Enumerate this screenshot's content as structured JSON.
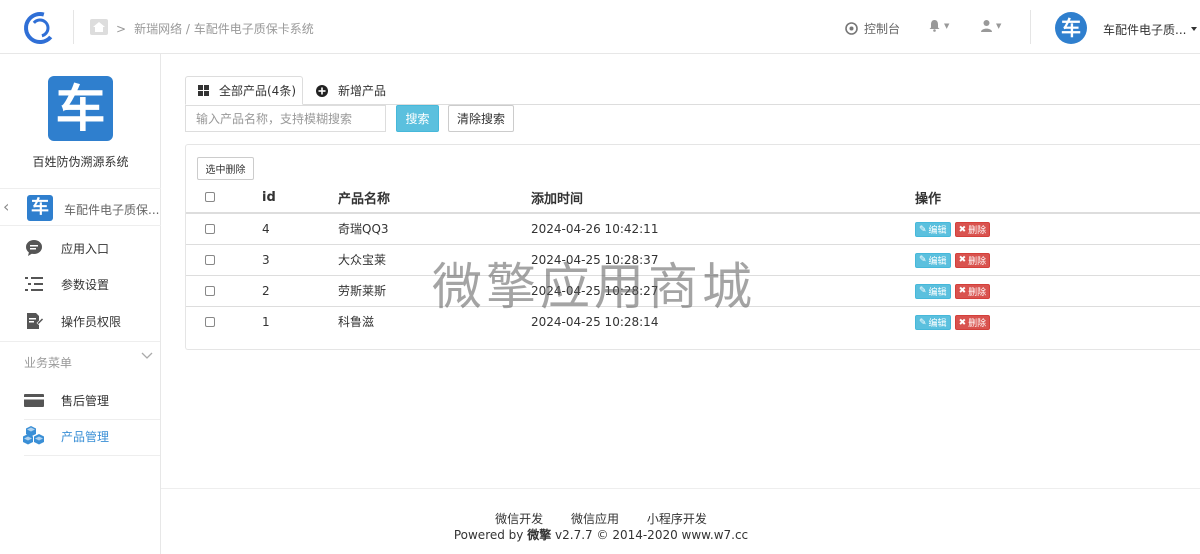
{
  "header": {
    "breadcrumb": "新瑞网络 / 车配件电子质保卡系统",
    "console": "控制台",
    "account_name": "车配件电子质...",
    "avatar_char": "车"
  },
  "sidebar": {
    "app_logo_char": "车",
    "app_name": "百姓防伪溯源系统",
    "sub_app_name": "车配件电子质保...",
    "items": [
      {
        "label": "应用入口",
        "icon": "chat-icon"
      },
      {
        "label": "参数设置",
        "icon": "list-settings-icon"
      },
      {
        "label": "操作员权限",
        "icon": "edit-doc-icon"
      }
    ],
    "section_label": "业务菜单",
    "biz_items": [
      {
        "label": "售后管理",
        "icon": "card-icon"
      },
      {
        "label": "产品管理",
        "icon": "cubes-icon",
        "active": true
      }
    ]
  },
  "tabs": [
    {
      "label": "全部产品(4条)",
      "icon": "grid-icon",
      "active": true
    },
    {
      "label": "新增产品",
      "icon": "plus-circle-icon"
    }
  ],
  "search": {
    "placeholder": "输入产品名称，支持模糊搜索",
    "value": "",
    "search_label": "搜索",
    "clear_label": "清除搜索"
  },
  "table": {
    "delete_selected_label": "选中删除",
    "headers": [
      "id",
      "产品名称",
      "添加时间",
      "操作"
    ],
    "rows": [
      {
        "id": "4",
        "name": "奇瑞QQ3",
        "time": "2024-04-26 10:42:11"
      },
      {
        "id": "3",
        "name": "大众宝莱",
        "time": "2024-04-25 10:28:37"
      },
      {
        "id": "2",
        "name": "劳斯莱斯",
        "time": "2024-04-25 10:28:27"
      },
      {
        "id": "1",
        "name": "科鲁滋",
        "time": "2024-04-25 10:28:14"
      }
    ],
    "edit_label": "编辑",
    "delete_label": "删除"
  },
  "watermark": "微擎应用商城",
  "footer": {
    "links": [
      "微信开发",
      "微信应用",
      "小程序开发"
    ],
    "powered_prefix": "Powered by ",
    "powered_brand": "微擎",
    "powered_suffix": " v2.7.7 © 2014-2020 www.w7.cc"
  },
  "colors": {
    "brand": "#2f7fce",
    "info": "#5bc0de",
    "danger": "#d9534f",
    "active_text": "#3a8fd6"
  }
}
